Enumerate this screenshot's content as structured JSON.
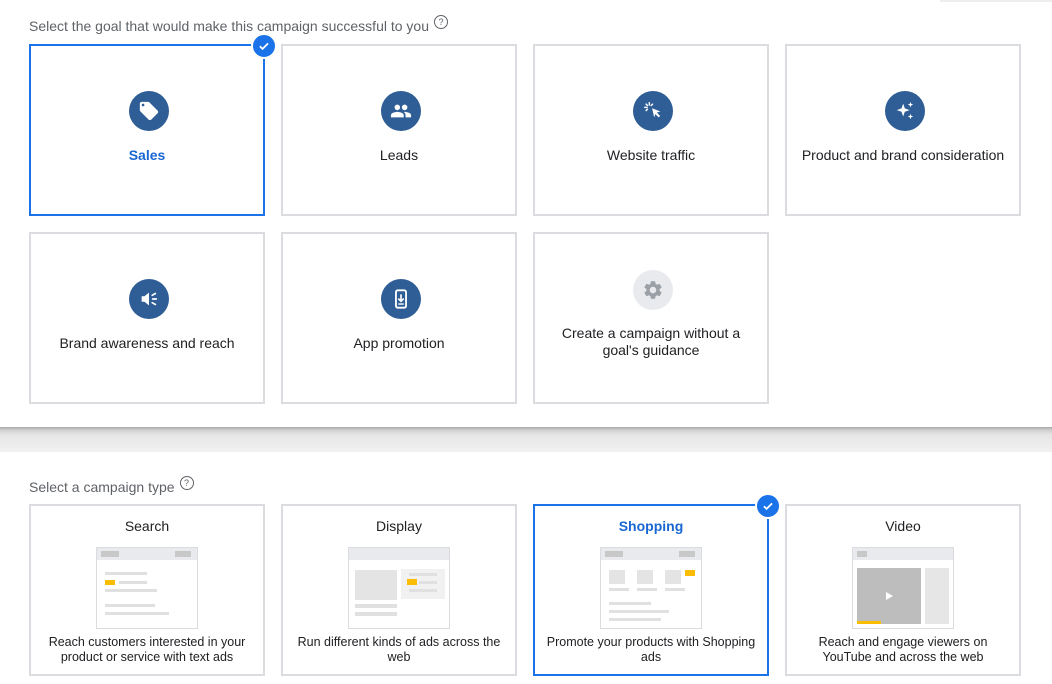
{
  "goal_section": {
    "label": "Select the goal that would make this campaign successful to you",
    "help_icon": "?"
  },
  "goals": [
    {
      "label": "Sales",
      "icon": "sell-tag-icon",
      "selected": true
    },
    {
      "label": "Leads",
      "icon": "people-icon",
      "selected": false
    },
    {
      "label": "Website traffic",
      "icon": "cursor-click-icon",
      "selected": false
    },
    {
      "label": "Product and brand consideration",
      "icon": "sparkle-icon",
      "selected": false
    },
    {
      "label": "Brand awareness and reach",
      "icon": "megaphone-icon",
      "selected": false
    },
    {
      "label": "App promotion",
      "icon": "phone-download-icon",
      "selected": false
    },
    {
      "label": "Create a campaign without a goal's guidance",
      "icon": "gear-icon",
      "selected": false
    }
  ],
  "type_section": {
    "label": "Select a campaign type",
    "help_icon": "?"
  },
  "campaign_types": [
    {
      "title": "Search",
      "description": "Reach customers interested in your product or service with text ads",
      "selected": false
    },
    {
      "title": "Display",
      "description": "Run different kinds of ads across the web",
      "selected": false
    },
    {
      "title": "Shopping",
      "description": "Promote your products with Shopping ads",
      "selected": true
    },
    {
      "title": "Video",
      "description": "Reach and engage viewers on YouTube and across the web",
      "selected": false
    }
  ],
  "colors": {
    "accent": "#1a73e8",
    "selected_text": "#1967d2",
    "icon_circle": "#2e5e95",
    "card_border": "#dadce0",
    "ad_highlight": "#fbbc04"
  }
}
